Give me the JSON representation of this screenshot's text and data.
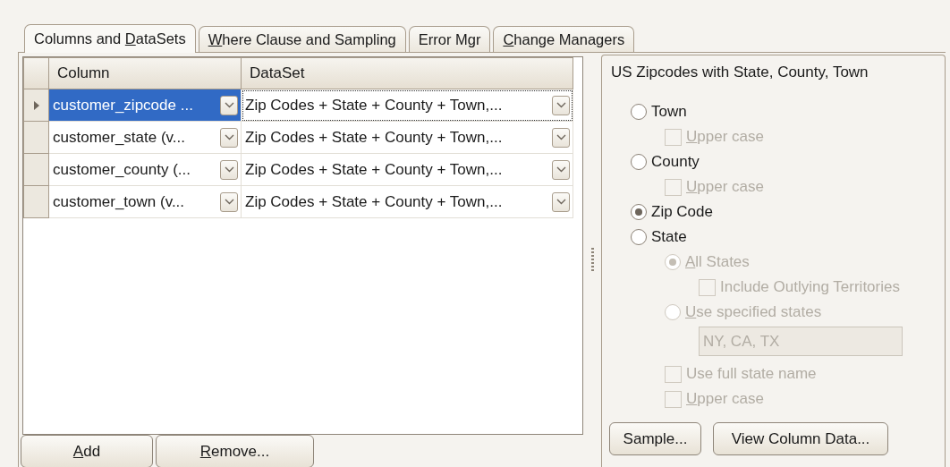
{
  "tabs": [
    {
      "label": {
        "before": "Columns and ",
        "key": "D",
        "after": "ataSets"
      },
      "selected": true
    },
    {
      "label": {
        "key": "W",
        "after": "here Clause and Sampling"
      },
      "selected": false
    },
    {
      "label": "Error Mgr",
      "selected": false
    },
    {
      "label": {
        "key": "C",
        "after": "hange Managers"
      },
      "selected": false
    }
  ],
  "grid": {
    "columns": [
      "Column",
      "DataSet"
    ],
    "rows": [
      {
        "column": "customer_zipcode ...",
        "dataset": "Zip Codes + State + County + Town,...",
        "selected": true
      },
      {
        "column": "customer_state (v...",
        "dataset": "Zip Codes + State + County + Town,...",
        "selected": false
      },
      {
        "column": "customer_county (...",
        "dataset": "Zip Codes + State + County + Town,...",
        "selected": false
      },
      {
        "column": "customer_town (v...",
        "dataset": "Zip Codes + State + County + Town,...",
        "selected": false
      }
    ]
  },
  "grid_buttons": [
    {
      "label": {
        "key": "A",
        "after": "dd"
      }
    },
    {
      "label": {
        "key": "R",
        "after": "emove..."
      }
    }
  ],
  "options": {
    "title": "US Zipcodes with State, County, Town",
    "items": [
      {
        "kind": "radio",
        "label": "Town",
        "selected": false,
        "disabled": false,
        "children": [
          {
            "kind": "checkbox",
            "label": {
              "key": "U",
              "after": "pper case"
            },
            "checked": false,
            "disabled": true
          }
        ]
      },
      {
        "kind": "radio",
        "label": "County",
        "selected": false,
        "disabled": false,
        "children": [
          {
            "kind": "checkbox",
            "label": {
              "key": "U",
              "after": "pper case"
            },
            "checked": false,
            "disabled": true
          }
        ]
      },
      {
        "kind": "radio",
        "label": "Zip Code",
        "selected": true,
        "disabled": false
      },
      {
        "kind": "radio",
        "label": "State",
        "selected": false,
        "disabled": false,
        "children": [
          {
            "kind": "radio",
            "label": {
              "key": "A",
              "after": "ll States"
            },
            "selected": true,
            "disabled": true,
            "children": [
              {
                "kind": "checkbox",
                "label": "Include Outlying Territories",
                "checked": false,
                "disabled": true
              }
            ]
          },
          {
            "kind": "radio",
            "label": {
              "key": "U",
              "after": "se specified states"
            },
            "selected": false,
            "disabled": true,
            "children": [
              {
                "kind": "field",
                "value": "NY, CA, TX",
                "disabled": true
              }
            ]
          },
          {
            "kind": "checkbox",
            "label": "Use full state name",
            "checked": false,
            "disabled": true
          },
          {
            "kind": "checkbox",
            "label": {
              "key": "U",
              "after": "pper case"
            },
            "checked": false,
            "disabled": true
          }
        ]
      }
    ],
    "buttons": [
      "Sample...",
      "View Column Data..."
    ]
  }
}
